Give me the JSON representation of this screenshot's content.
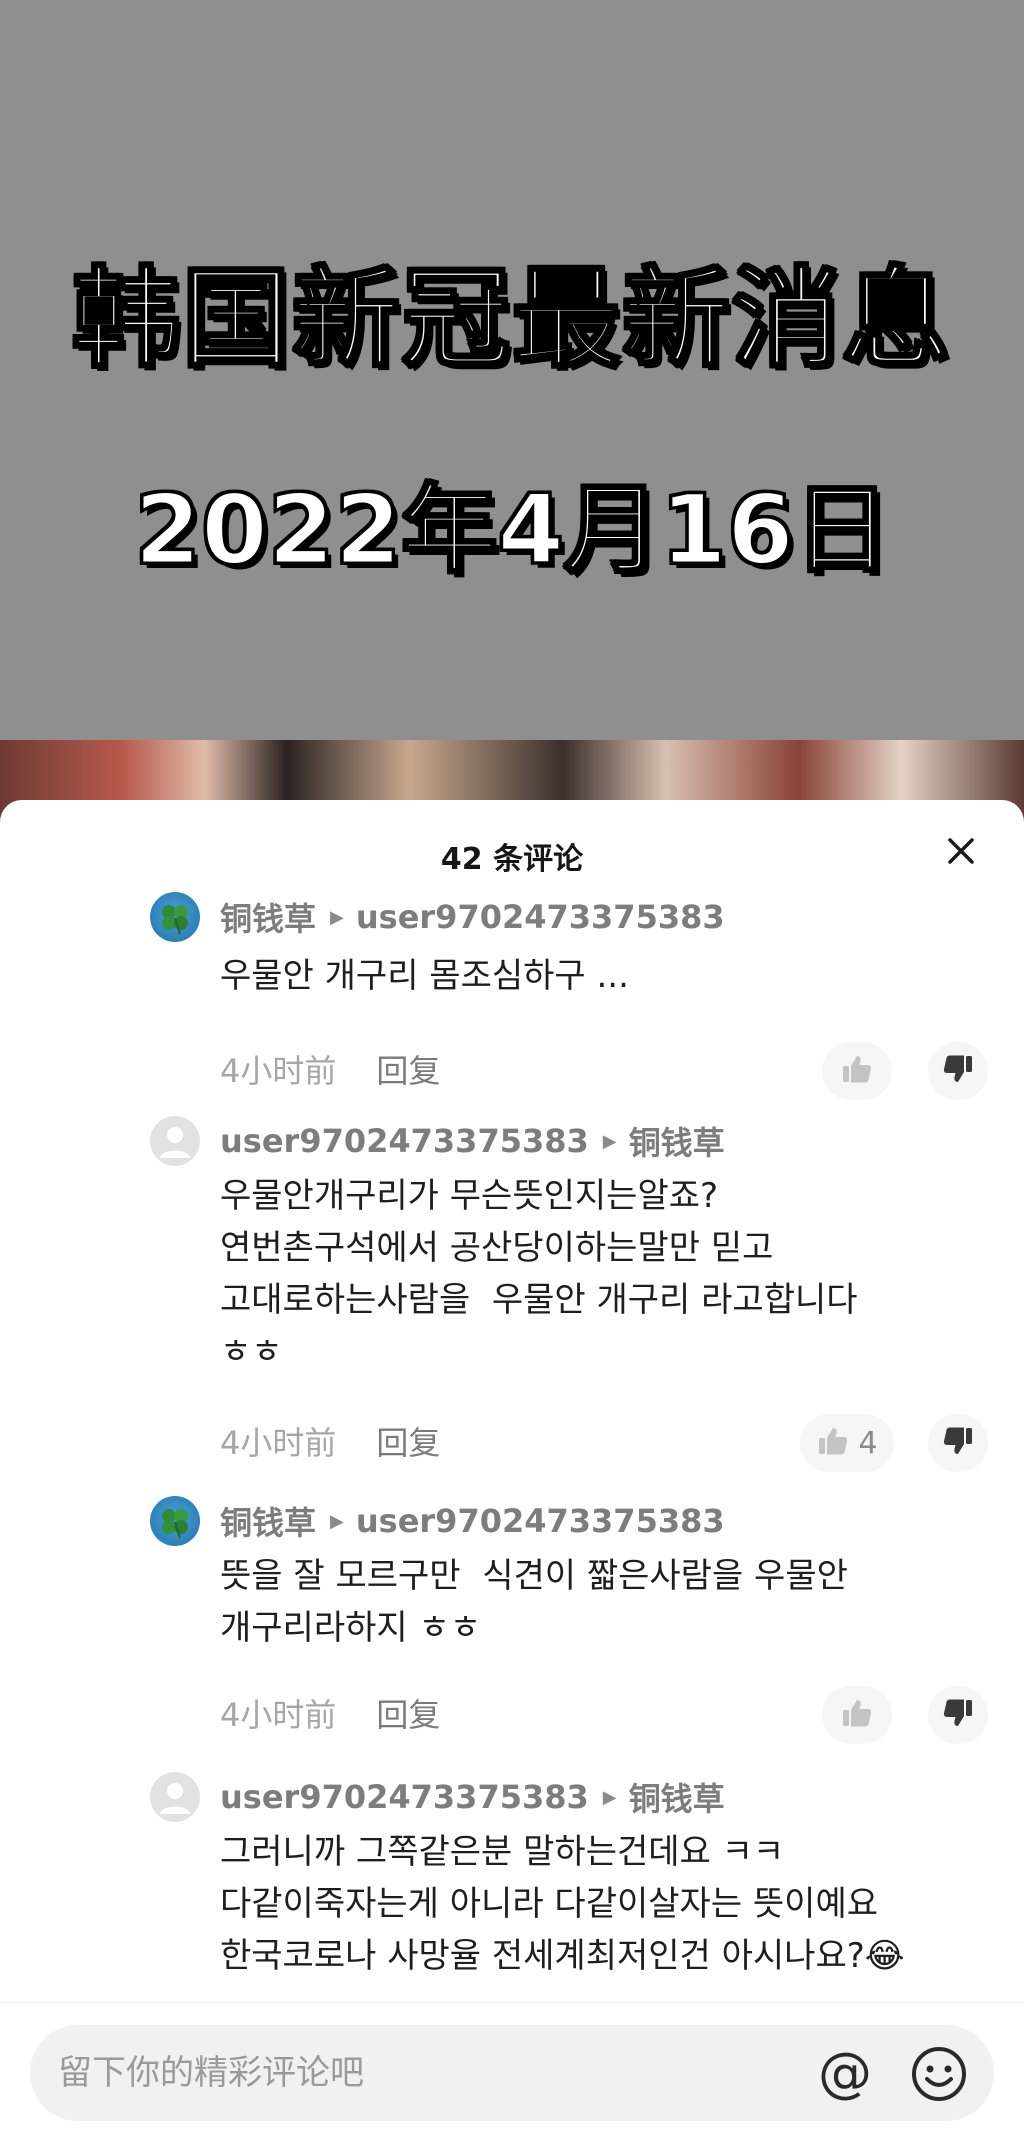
{
  "video": {
    "title": "韩国新冠最新消息",
    "date": "2022年4月16日"
  },
  "sheet": {
    "title": "42 条评论"
  },
  "comments": [
    {
      "author": "铜钱草",
      "reply_to": "user9702473375383",
      "avatar": "clover-avatar",
      "text": "우물안 개구리 몸조심하구 ...",
      "time": "4小时前",
      "reply_label": "回复",
      "likes": ""
    },
    {
      "author": "user9702473375383",
      "reply_to": "铜钱草",
      "avatar": "default-avatar",
      "text": "우물안개구리가 무슨뜻인지는알죠?\n연번촌구석에서 공산당이하는말만 믿고\n고대로하는사람을  우물안 개구리 라고합니다\nㅎㅎ",
      "time": "4小时前",
      "reply_label": "回复",
      "likes": "4"
    },
    {
      "author": "铜钱草",
      "reply_to": "user9702473375383",
      "avatar": "clover-avatar",
      "text": "뜻을 잘 모르구만  식견이 짧은사람을 우물안\n개구리라하지 ㅎㅎ",
      "time": "4小时前",
      "reply_label": "回复",
      "likes": ""
    },
    {
      "author": "user9702473375383",
      "reply_to": "铜钱草",
      "avatar": "default-avatar",
      "text": "그러니까 그쪽같은분 말하는건데요 ㅋㅋ\n다같이죽자는게 아니라 다같이살자는 뜻이예요\n한국코로나 사망율 전세계최저인건 아시나요?😂",
      "time": "",
      "reply_label": "",
      "likes": ""
    }
  ],
  "input": {
    "placeholder": "留下你的精彩评论吧",
    "at_symbol": "@"
  },
  "icons": {
    "close": "close-icon",
    "like": "thumbs-up-icon",
    "dislike": "thumbs-down-icon",
    "arrow": "play-arrow-icon",
    "emoji": "smiley-icon"
  }
}
